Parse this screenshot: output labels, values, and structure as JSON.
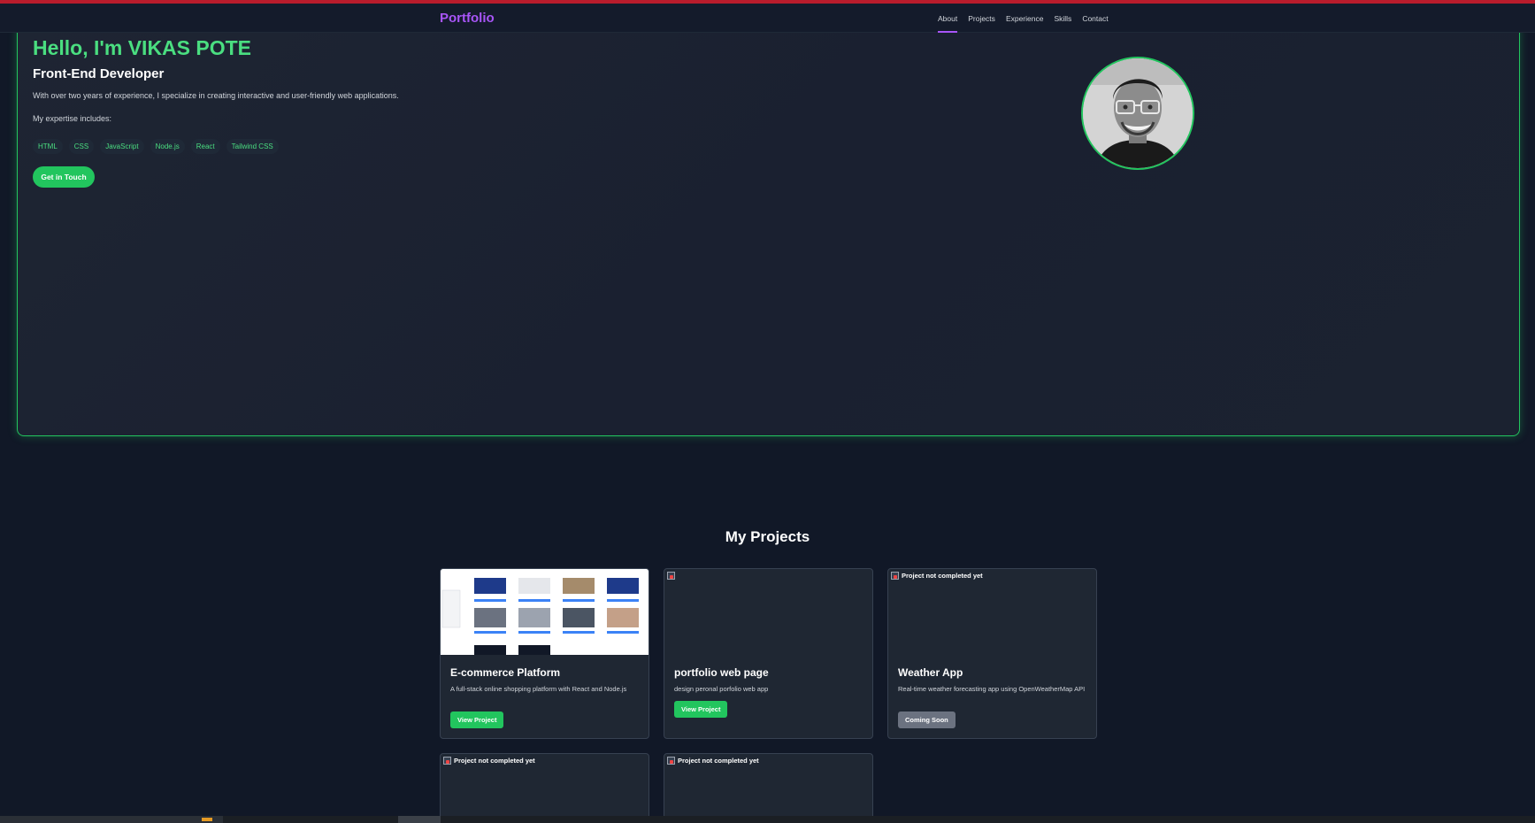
{
  "nav": {
    "brand": "Portfolio",
    "links": [
      "About",
      "Projects",
      "Experience",
      "Skills",
      "Contact"
    ],
    "active": "About"
  },
  "hero": {
    "title": "Hello, I'm VIKAS POTE",
    "subtitle": "Front-End Developer",
    "description": "With over two years of experience, I specialize in creating interactive and user-friendly web applications.",
    "expertise_label": "My expertise includes:",
    "tags": [
      "HTML",
      "CSS",
      "JavaScript",
      "Node.js",
      "React",
      "Tailwind CSS"
    ],
    "cta_label": "Get in Touch"
  },
  "projects": {
    "title": "My Projects",
    "cards": [
      {
        "title": "E-commerce Platform",
        "description": "A full-stack online shopping platform with React and Node.js",
        "button": "View Project"
      },
      {
        "title": "portfolio web page",
        "description": "design peronal porfolio web app",
        "button": "View Project"
      },
      {
        "title": "Weather App",
        "description": "Real-time weather forecasting app using OpenWeatherMap API",
        "button": "Coming Soon",
        "image_alt": "Project not completed yet"
      },
      {
        "image_alt": "Project not completed yet"
      },
      {
        "image_alt": "Project not completed yet"
      }
    ]
  },
  "colors": {
    "accent_green": "#22c55e",
    "brand_purple": "#a855f7",
    "background": "#111827"
  }
}
